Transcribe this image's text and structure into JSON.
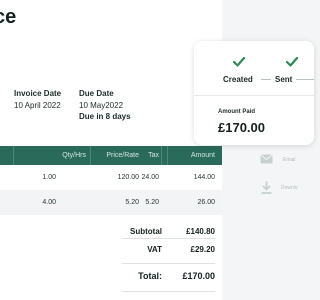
{
  "page": {
    "title": "ce"
  },
  "meta": {
    "invoice_date_label": "Invoice Date",
    "invoice_date": "10 April 2022",
    "due_date_label": "Due Date",
    "due_date": "10 May2022",
    "due_note": "Due in 8 days"
  },
  "table": {
    "headers": [
      "Qty/Hrs",
      "Price/Rate",
      "Tax",
      "Amount"
    ],
    "rows": [
      [
        "1.00",
        "120.00",
        "24.00",
        "144.00"
      ],
      [
        "4.00",
        "5.20",
        "5.20",
        "26.00"
      ]
    ]
  },
  "totals": {
    "subtotal_label": "Subtotal",
    "subtotal": "£140.80",
    "vat_label": "VAT",
    "vat": "£29.20",
    "total_label": "Total:",
    "total": "£170.00"
  },
  "status": {
    "steps": [
      "Created",
      "Sent"
    ],
    "amount_paid_label": "Amount Paid",
    "amount_paid": "£170.00"
  },
  "side_actions": {
    "email": "Email",
    "download": "Downlo"
  },
  "colors": {
    "accent": "#2a6a5a",
    "check": "#2e8b57",
    "muted": "#b4bcbc"
  },
  "icons": {
    "email": "envelope-icon",
    "download": "download-icon",
    "step": "check-icon"
  }
}
